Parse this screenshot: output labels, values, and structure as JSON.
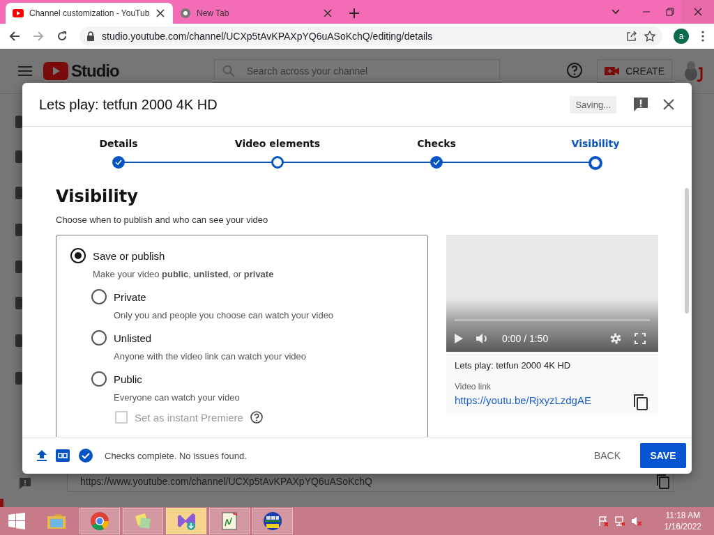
{
  "browser": {
    "tabs": [
      {
        "title": "Channel customization - YouTub",
        "selected": true,
        "kind": "youtube"
      },
      {
        "title": "New Tab",
        "selected": false,
        "kind": "chrome"
      }
    ],
    "address": "studio.youtube.com/channel/UCXp5tAvKPAXpYQ6uASoKchQ/editing/details",
    "profile": "a"
  },
  "studio": {
    "logo": "Studio",
    "search_placeholder": "Search across your channel",
    "create": "CREATE",
    "channel_link": "https://www.youtube.com/channel/UCXp5tAvKPAXpYQ6uASoKchQ"
  },
  "dialog": {
    "title": "Lets play: tetfun 2000 4K HD",
    "status": "Saving...",
    "steps": [
      {
        "label": "Details",
        "kind": "done",
        "selected": false
      },
      {
        "label": "Video elements",
        "kind": "open",
        "selected": false
      },
      {
        "label": "Checks",
        "kind": "done",
        "selected": false
      },
      {
        "label": "Visibility",
        "kind": "open",
        "selected": true
      }
    ],
    "heading": "Visibility",
    "subtitle": "Choose when to publish and who can see your video",
    "save_or_publish": {
      "label": "Save or publish",
      "description": "Make your video **public**, **unlisted**, or **private**",
      "selected": true
    },
    "options": [
      {
        "label": "Private",
        "description": "Only you and people you choose can watch your video",
        "selected": false
      },
      {
        "label": "Unlisted",
        "description": "Anyone with the video link can watch your video",
        "selected": false
      },
      {
        "label": "Public",
        "description": "Everyone can watch your video",
        "selected": false
      }
    ],
    "premiere": {
      "label": "Set as instant Premiere",
      "checked": false,
      "disabled": true
    },
    "preview": {
      "time": "0:00 / 1:50",
      "video_title": "Lets play: tetfun 2000 4K HD",
      "link_label": "Video link",
      "link": "https://youtu.be/RjxyzLzdgAE"
    },
    "footer_status": "Checks complete. No issues found.",
    "back": "BACK",
    "save": "SAVE"
  },
  "taskbar": {
    "apps": [
      {
        "kind": "folder",
        "running": false,
        "focused": false
      },
      {
        "kind": "chrome",
        "running": true,
        "focused": false
      },
      {
        "kind": "notes",
        "running": true,
        "focused": false
      },
      {
        "kind": "studio",
        "running": true,
        "focused": true
      },
      {
        "kind": "notepad",
        "running": true,
        "focused": false
      },
      {
        "kind": "game",
        "running": true,
        "focused": false
      }
    ],
    "time": "11:18 AM",
    "date": "1/16/2022"
  }
}
